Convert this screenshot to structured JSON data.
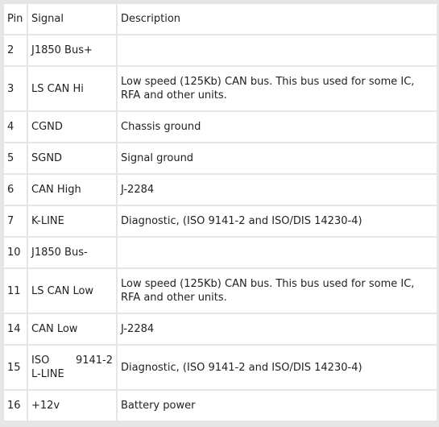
{
  "header": {
    "pin": "Pin",
    "signal": "Signal",
    "description": "Description"
  },
  "rows": [
    {
      "pin": "2",
      "signal": "J1850 Bus+",
      "description": ""
    },
    {
      "pin": "3",
      "signal": "LS CAN Hi",
      "description": "Low speed (125Kb) CAN bus. This bus used for some IC, RFA and other units."
    },
    {
      "pin": "4",
      "signal": "CGND",
      "description": "Chassis ground"
    },
    {
      "pin": "5",
      "signal": "SGND",
      "description": "Signal ground"
    },
    {
      "pin": "6",
      "signal": "CAN High",
      "description": "J-2284"
    },
    {
      "pin": "7",
      "signal": "K-LINE",
      "description": "Diagnostic, (ISO 9141-2 and ISO/DIS 14230-4)"
    },
    {
      "pin": "10",
      "signal": "J1850 Bus-",
      "description": ""
    },
    {
      "pin": "11",
      "signal": "LS CAN Low",
      "description": "Low speed (125Kb) CAN bus. This bus used for some IC, RFA and other units."
    },
    {
      "pin": "14",
      "signal": "CAN Low",
      "description": "J-2284"
    },
    {
      "pin": "15",
      "signal_parts": [
        "ISO",
        "9141-2",
        "L-LINE"
      ],
      "description": "Diagnostic, (ISO 9141-2 and ISO/DIS 14230-4)"
    },
    {
      "pin": "16",
      "signal": "+12v",
      "description": "Battery power"
    }
  ]
}
